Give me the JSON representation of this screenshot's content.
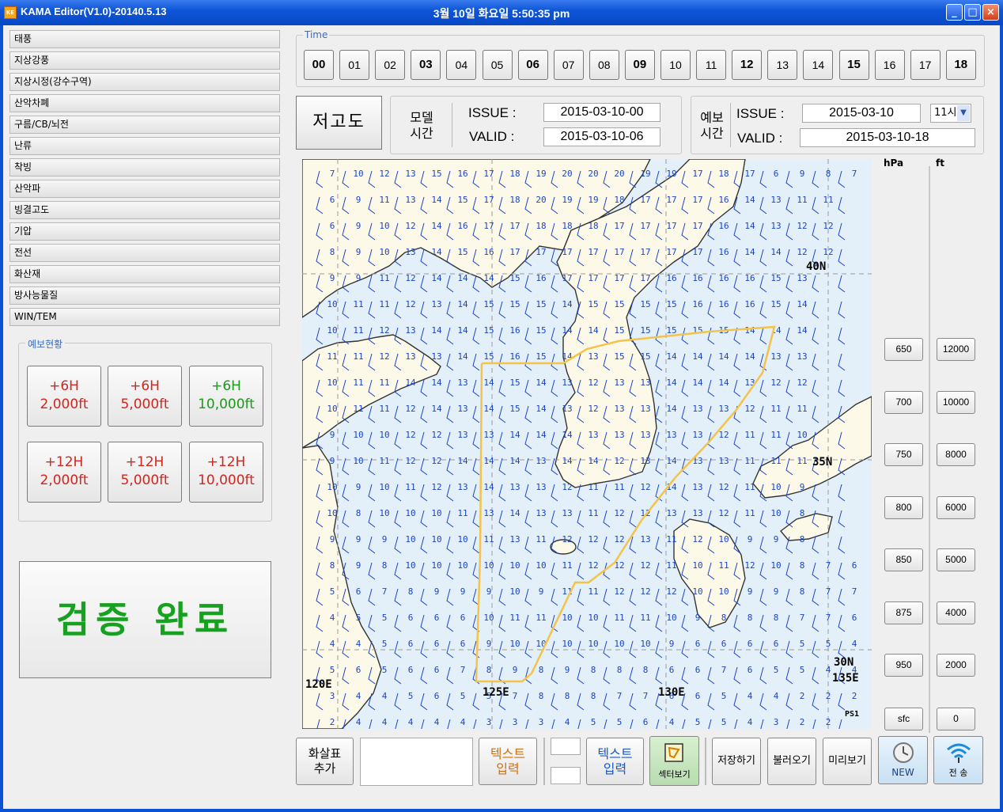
{
  "window": {
    "title": "KAMA Editor(V1.0)-20140.5.13",
    "clock": "3월 10일   화요일   5:50:35 pm",
    "app_icon": "KE",
    "controls": [
      "_",
      "□",
      "×"
    ]
  },
  "menu": [
    "태풍",
    "지상강풍",
    "지상시정(강수구역)",
    "산악차폐",
    "구름/CB/뇌전",
    "난류",
    "착빙",
    "산악파",
    "빙결고도",
    "기압",
    "전선",
    "화산재",
    "방사능물질",
    "WIN/TEM"
  ],
  "forecast_group": {
    "label": "예보현황",
    "buttons": [
      {
        "line1": "+6H",
        "line2": "2,000ft",
        "color": "#d0261f"
      },
      {
        "line1": "+6H",
        "line2": "5,000ft",
        "color": "#d0261f"
      },
      {
        "line1": "+6H",
        "line2": "10,000ft",
        "color": "#1a9a18"
      },
      {
        "line1": "+12H",
        "line2": "2,000ft",
        "color": "#d0261f"
      },
      {
        "line1": "+12H",
        "line2": "5,000ft",
        "color": "#d0261f"
      },
      {
        "line1": "+12H",
        "line2": "10,000ft",
        "color": "#d0261f"
      }
    ]
  },
  "verify_button": "검증 완료",
  "time_group": {
    "label": "Time",
    "hours": [
      "00",
      "01",
      "02",
      "03",
      "04",
      "05",
      "06",
      "07",
      "08",
      "09",
      "10",
      "11",
      "12",
      "13",
      "14",
      "15",
      "16",
      "17",
      "18"
    ],
    "bold_hours": [
      "00",
      "03",
      "06",
      "09",
      "12",
      "15",
      "18"
    ]
  },
  "chart_button": "저고도",
  "model_time": {
    "label": "모델\n시간",
    "issue_label": "ISSUE :",
    "issue_value": "2015-03-10-00",
    "valid_label": "VALID :",
    "valid_value": "2015-03-10-06"
  },
  "forecast_time": {
    "label": "예보\n시간",
    "issue_label": "ISSUE :",
    "issue_value": "2015-03-10",
    "hour_select": "11시",
    "valid_label": "VALID :",
    "valid_value": "2015-03-10-18"
  },
  "map": {
    "lat_labels": [
      "40N",
      "35N",
      "30N"
    ],
    "lon_labels": [
      "120E",
      "125E",
      "130E",
      "135E"
    ],
    "credit": "PS1",
    "wind_rows": [
      [
        "7",
        "10",
        "12",
        "13",
        "15",
        "16",
        "17",
        "18",
        "19",
        "20",
        "20",
        "20",
        "19",
        "19",
        "17",
        "18",
        "17",
        "6",
        "9",
        "8",
        "7"
      ],
      [
        "6",
        "9",
        "11",
        "13",
        "14",
        "15",
        "17",
        "18",
        "20",
        "19",
        "19",
        "18",
        "17",
        "17",
        "17",
        "16",
        "14",
        "13",
        "11",
        "11",
        "-"
      ],
      [
        "6",
        "9",
        "10",
        "12",
        "14",
        "16",
        "17",
        "17",
        "18",
        "18",
        "18",
        "17",
        "17",
        "17",
        "17",
        "16",
        "14",
        "13",
        "12",
        "12",
        "-"
      ],
      [
        "8",
        "9",
        "10",
        "13",
        "14",
        "15",
        "16",
        "17",
        "17",
        "17",
        "17",
        "17",
        "17",
        "17",
        "17",
        "16",
        "14",
        "14",
        "12",
        "12",
        "-"
      ],
      [
        "9",
        "9",
        "11",
        "12",
        "14",
        "14",
        "14",
        "15",
        "16",
        "17",
        "17",
        "17",
        "17",
        "16",
        "16",
        "16",
        "16",
        "15",
        "13",
        "-",
        "-"
      ],
      [
        "10",
        "11",
        "11",
        "12",
        "13",
        "14",
        "15",
        "15",
        "15",
        "14",
        "15",
        "15",
        "15",
        "15",
        "16",
        "16",
        "16",
        "15",
        "14",
        "-",
        "-"
      ],
      [
        "10",
        "11",
        "12",
        "13",
        "14",
        "14",
        "15",
        "16",
        "15",
        "14",
        "14",
        "15",
        "15",
        "15",
        "15",
        "15",
        "14",
        "14",
        "14",
        "-",
        "-"
      ],
      [
        "11",
        "11",
        "12",
        "13",
        "13",
        "14",
        "15",
        "16",
        "15",
        "14",
        "13",
        "15",
        "15",
        "14",
        "14",
        "14",
        "14",
        "13",
        "13",
        "-",
        "-"
      ],
      [
        "10",
        "11",
        "11",
        "14",
        "14",
        "13",
        "14",
        "15",
        "14",
        "13",
        "12",
        "13",
        "13",
        "14",
        "14",
        "14",
        "13",
        "12",
        "12",
        "-",
        "-"
      ],
      [
        "10",
        "11",
        "11",
        "12",
        "14",
        "13",
        "14",
        "15",
        "14",
        "13",
        "12",
        "13",
        "13",
        "14",
        "13",
        "13",
        "12",
        "11",
        "11",
        "-",
        "-"
      ],
      [
        "9",
        "10",
        "10",
        "12",
        "12",
        "13",
        "13",
        "14",
        "14",
        "14",
        "13",
        "13",
        "13",
        "13",
        "13",
        "12",
        "11",
        "11",
        "10",
        "-",
        "-"
      ],
      [
        "9",
        "10",
        "11",
        "12",
        "12",
        "14",
        "14",
        "14",
        "13",
        "14",
        "14",
        "12",
        "13",
        "14",
        "13",
        "13",
        "11",
        "11",
        "11",
        "-",
        "-"
      ],
      [
        "10",
        "9",
        "10",
        "11",
        "12",
        "13",
        "14",
        "13",
        "13",
        "12",
        "11",
        "11",
        "12",
        "14",
        "13",
        "12",
        "11",
        "10",
        "9",
        "-",
        "-"
      ],
      [
        "10",
        "8",
        "10",
        "10",
        "10",
        "11",
        "13",
        "14",
        "13",
        "13",
        "11",
        "12",
        "12",
        "13",
        "13",
        "12",
        "11",
        "10",
        "8",
        "-",
        "-"
      ],
      [
        "9",
        "9",
        "9",
        "10",
        "10",
        "10",
        "11",
        "13",
        "11",
        "12",
        "12",
        "12",
        "13",
        "11",
        "12",
        "10",
        "9",
        "9",
        "8",
        "-",
        "-"
      ],
      [
        "8",
        "9",
        "8",
        "10",
        "10",
        "10",
        "10",
        "10",
        "10",
        "11",
        "12",
        "12",
        "12",
        "11",
        "10",
        "11",
        "12",
        "10",
        "8",
        "7",
        "6"
      ],
      [
        "5",
        "6",
        "7",
        "8",
        "9",
        "9",
        "9",
        "10",
        "9",
        "11",
        "11",
        "12",
        "12",
        "12",
        "10",
        "10",
        "9",
        "9",
        "8",
        "7",
        "7"
      ],
      [
        "4",
        "5",
        "5",
        "6",
        "6",
        "6",
        "10",
        "11",
        "11",
        "10",
        "10",
        "11",
        "11",
        "10",
        "9",
        "8",
        "8",
        "8",
        "7",
        "7",
        "6"
      ],
      [
        "4",
        "4",
        "5",
        "6",
        "6",
        "6",
        "9",
        "10",
        "10",
        "10",
        "10",
        "10",
        "10",
        "9",
        "6",
        "6",
        "6",
        "6",
        "5",
        "5",
        "4"
      ],
      [
        "5",
        "6",
        "5",
        "6",
        "6",
        "7",
        "8",
        "9",
        "8",
        "9",
        "8",
        "8",
        "8",
        "6",
        "6",
        "7",
        "6",
        "5",
        "5",
        "4",
        "4"
      ],
      [
        "3",
        "4",
        "4",
        "5",
        "6",
        "5",
        "5",
        "7",
        "8",
        "8",
        "8",
        "7",
        "7",
        "6",
        "6",
        "5",
        "4",
        "4",
        "2",
        "2",
        "2"
      ],
      [
        "2",
        "4",
        "4",
        "4",
        "4",
        "4",
        "3",
        "3",
        "3",
        "4",
        "5",
        "5",
        "6",
        "4",
        "5",
        "5",
        "4",
        "3",
        "2",
        "2",
        "-"
      ]
    ]
  },
  "altitude": {
    "hpa_label": "hPa",
    "ft_label": "ft",
    "hpa": [
      "650",
      "700",
      "750",
      "800",
      "850",
      "875",
      "950",
      "sfc"
    ],
    "ft": [
      "12000",
      "10000",
      "8000",
      "6000",
      "5000",
      "4000",
      "2000",
      "0"
    ]
  },
  "toolbar": {
    "add_arrow": "화살표\n추가",
    "text_input_1": "텍스트\n입력",
    "text_input_2": "텍스트\n입력",
    "sector_view": "섹터보기",
    "save": "저장하기",
    "load": "불러오기",
    "preview": "미리보기",
    "new": "NEW",
    "send": "전 송"
  },
  "colors": {
    "accent_blue": "#3a6bbf",
    "verify_green": "#18a020",
    "fcst_red": "#d0261f",
    "wind_text": "#1b44c8",
    "sea": "#e3f0fa",
    "land": "#fdf9e8",
    "polygon": "#f3c34a"
  },
  "icons": [
    "app-icon",
    "minimize-icon",
    "maximize-icon",
    "close-icon",
    "chevron-down-icon",
    "sector-map-icon",
    "clock-icon",
    "wifi-send-icon"
  ]
}
